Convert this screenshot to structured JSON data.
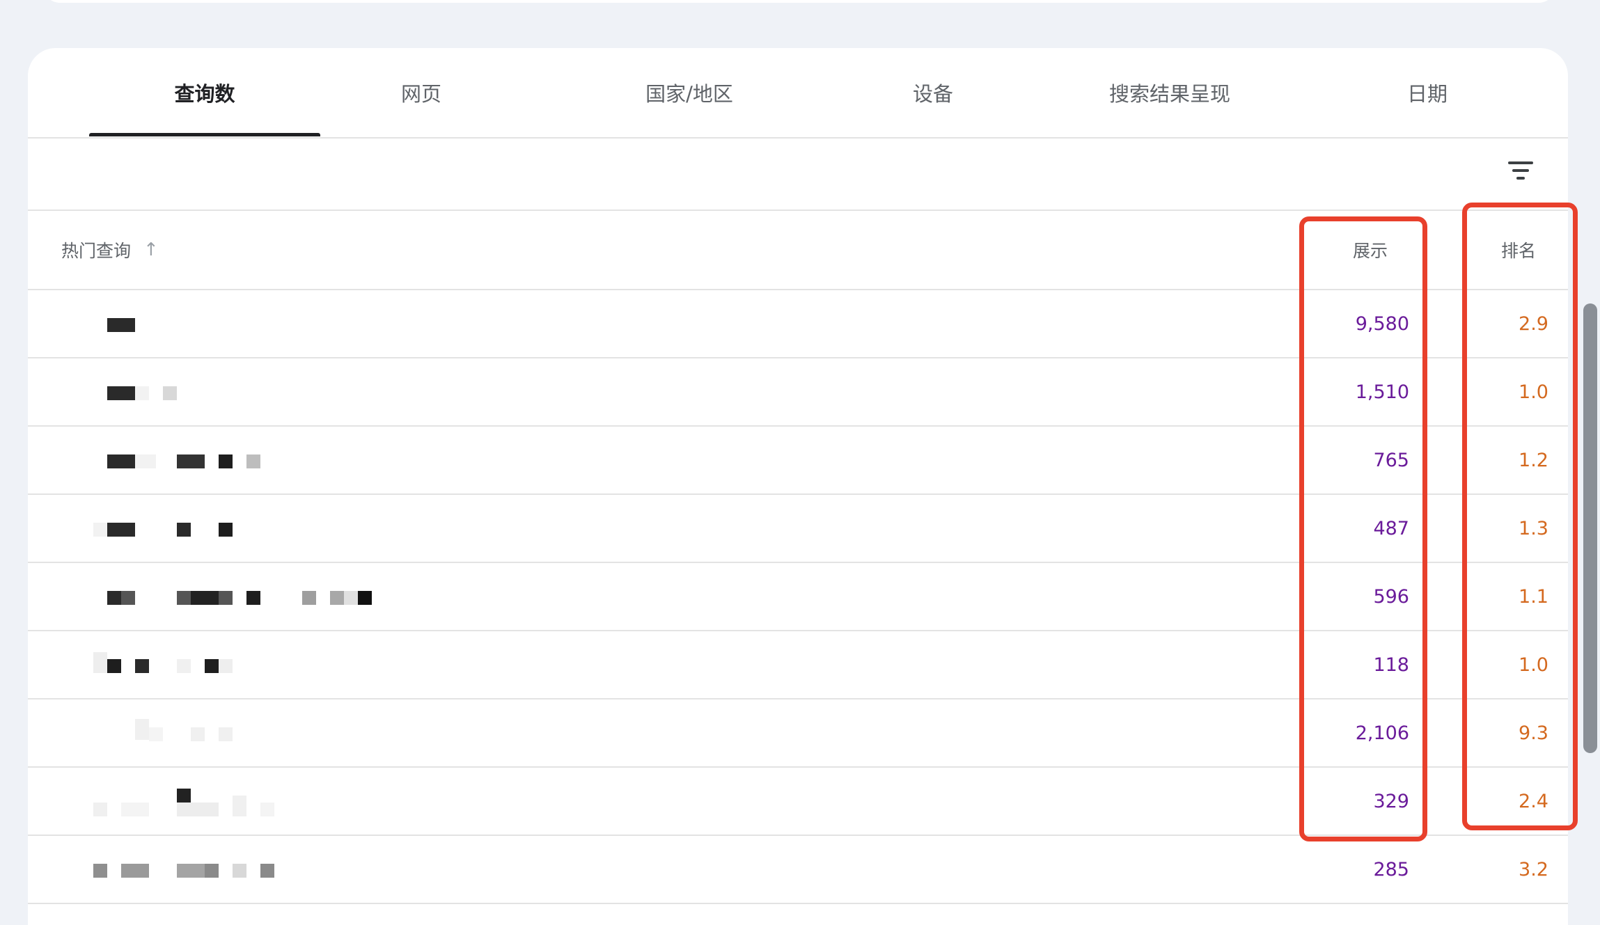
{
  "tabs": [
    {
      "label": "查询数",
      "active": true
    },
    {
      "label": "网页",
      "active": false
    },
    {
      "label": "国家/地区",
      "active": false
    },
    {
      "label": "设备",
      "active": false
    },
    {
      "label": "搜索结果呈现",
      "active": false
    },
    {
      "label": "日期",
      "active": false
    }
  ],
  "filter": {
    "icon": "filter-list-icon"
  },
  "table": {
    "headers": {
      "query": "热门查询",
      "sort_icon": "arrow-upward-icon",
      "impressions": "展示",
      "position": "排名"
    },
    "rows": [
      {
        "query": "[redacted]",
        "impressions": "9,580",
        "position": "2.9"
      },
      {
        "query": "[redacted]",
        "impressions": "1,510",
        "position": "1.0"
      },
      {
        "query": "[redacted]",
        "impressions": "765",
        "position": "1.2"
      },
      {
        "query": "[redacted]",
        "impressions": "487",
        "position": "1.3"
      },
      {
        "query": "[redacted]",
        "impressions": "596",
        "position": "1.1"
      },
      {
        "query": "[redacted]",
        "impressions": "118",
        "position": "1.0"
      },
      {
        "query": "[redacted]",
        "impressions": "2,106",
        "position": "9.3"
      },
      {
        "query": "[redacted]",
        "impressions": "329",
        "position": "2.4"
      },
      {
        "query": "[redacted]",
        "impressions": "285",
        "position": "3.2"
      }
    ]
  },
  "colors": {
    "impressions_text": "#6a1b9a",
    "position_text": "#d4691f",
    "highlight_border": "#e8402c",
    "page_background": "#eff2f7"
  },
  "annotations": [
    "red-box-around-impressions-column",
    "red-box-around-position-column"
  ]
}
